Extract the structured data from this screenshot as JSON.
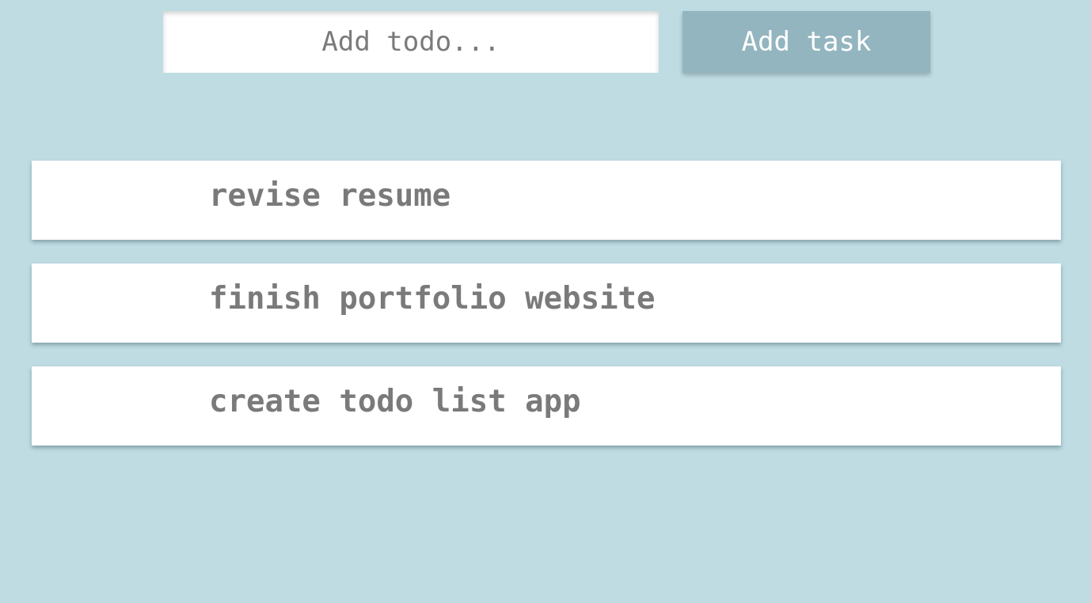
{
  "form": {
    "input_placeholder": "Add todo...",
    "input_value": "",
    "add_button_label": "Add task"
  },
  "todos": [
    {
      "text": "revise resume"
    },
    {
      "text": "finish portfolio website"
    },
    {
      "text": "create todo list app"
    }
  ],
  "colors": {
    "background": "#bfdce3",
    "button": "#93b5bf",
    "item_background": "#ffffff",
    "item_text": "#7a7a7a"
  }
}
